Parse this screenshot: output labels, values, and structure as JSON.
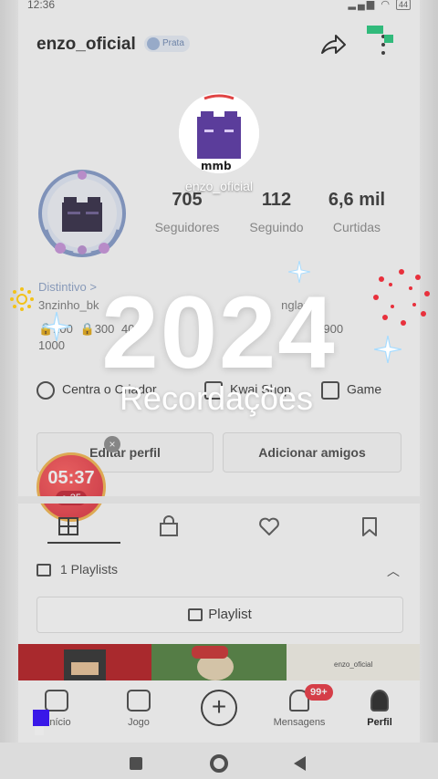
{
  "status_bar": {
    "time": "12:36",
    "battery": "44"
  },
  "header": {
    "username": "enzo_oficial",
    "badge": "Prata"
  },
  "overlay": {
    "top_name": "enzo_oficial",
    "year": "2024",
    "subtitle": "Recordações"
  },
  "stats": [
    {
      "value": "705",
      "label": "Seguidores"
    },
    {
      "value": "112",
      "label": "Seguindo"
    },
    {
      "value": "6,6 mil",
      "label": "Curtidas"
    }
  ],
  "bio": {
    "distintivo": "Distintivo >",
    "line2": "3nzinho_bk",
    "line2_end": "ngland",
    "line3": "1000",
    "line3_mid1": "200",
    "line3_mid2": "300",
    "line3_mid3": "400",
    "line3_end": "900"
  },
  "links": [
    {
      "label": "Centra o Criador"
    },
    {
      "label": "Kwai Shop"
    },
    {
      "label": "Game"
    }
  ],
  "buttons": {
    "edit_profile": "Editar perfil",
    "add_friends": "Adicionar amigos"
  },
  "timer": {
    "time": "05:37",
    "coins": "25"
  },
  "playlists": {
    "count_label": "1 Playlists",
    "button": "Playlist"
  },
  "thumb_label": "enzo_oficial",
  "nav": {
    "inicio": "nício",
    "jogo": "Jogo",
    "mensagens": "Mensagens",
    "perfil": "Perfil",
    "notif_count": "99+"
  },
  "colors": {
    "accent_red": "#e8303c",
    "badge_blue": "#6a84b0",
    "sticker_green": "#20c77a"
  }
}
